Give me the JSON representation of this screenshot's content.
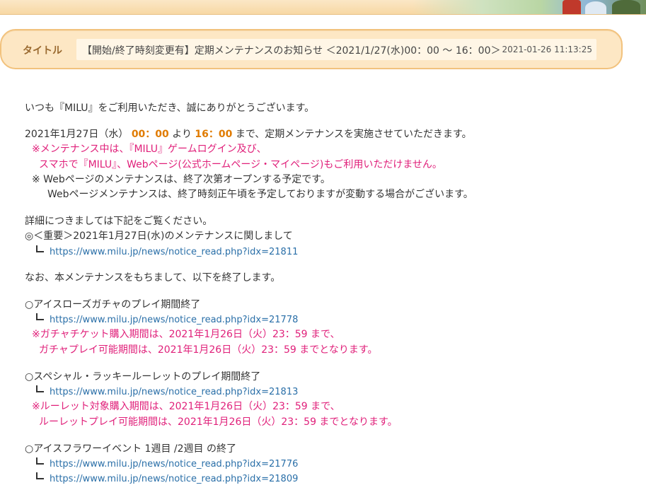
{
  "header": {
    "title_label": "タイトル",
    "title": "【開始/終了時刻変更有】定期メンテナンスのお知らせ ＜2021/1/27(水)00：00 ～ 16：00＞",
    "date": "2021-01-26 11:13:25"
  },
  "body": {
    "greeting": "いつも『MILU』をご利用いただき、誠にありがとうございます。",
    "schedule": {
      "date": "2021年1月27日（水）",
      "start": "00：00",
      "from_word": "より",
      "end": "16：00",
      "suffix": "まで、定期メンテナンスを実施させていただきます。"
    },
    "warning_line1": "※メンテナンス中は、『MILU』ゲームログイン及び、",
    "warning_line2": "スマホで『MILU』、Webページ(公式ホームページ・マイページ)もご利用いただけません。",
    "note_line1": "※ Webページのメンテナンスは、終了次第オープンする予定です。",
    "note_line2": "Webページメンテナンスは、終了時刻正午頃を予定しておりますが変動する場合がございます。",
    "details_intro": "詳細につきましては下記をご覧ください。",
    "important_title": "◎＜重要＞2021年1月27日(水)のメンテナンスに関しまして",
    "important_link": "https://www.milu.jp/news/notice_read.php?idx=21811",
    "end_intro": "なお、本メンテナンスをもちまして、以下を終了します。",
    "sections": [
      {
        "title": "○アイスローズガチャのプレイ期間終了",
        "links": [
          "https://www.milu.jp/news/notice_read.php?idx=21778"
        ],
        "notes": [
          "※ガチャチケット購入期間は、2021年1月26日（火）23：59 まで、",
          "ガチャプレイ可能期間は、2021年1月26日（火）23：59 までとなります。"
        ]
      },
      {
        "title": "○スペシャル・ラッキールーレットのプレイ期間終了",
        "links": [
          "https://www.milu.jp/news/notice_read.php?idx=21813"
        ],
        "notes": [
          "※ルーレット対象購入期間は、2021年1月26日（火）23：59 まで、",
          "ルーレットプレイ可能期間は、2021年1月26日（火）23：59 までとなります。"
        ]
      },
      {
        "title": "○アイスフラワーイベント 1週目 /2週目 の終了",
        "links": [
          "https://www.milu.jp/news/notice_read.php?idx=21776",
          "https://www.milu.jp/news/notice_read.php?idx=21809"
        ],
        "notes": []
      }
    ]
  },
  "colors": {
    "accent_red": "#e0207a",
    "accent_orange": "#e07b00",
    "link": "#2a6fa8",
    "title_bg": "#fde7c4"
  }
}
